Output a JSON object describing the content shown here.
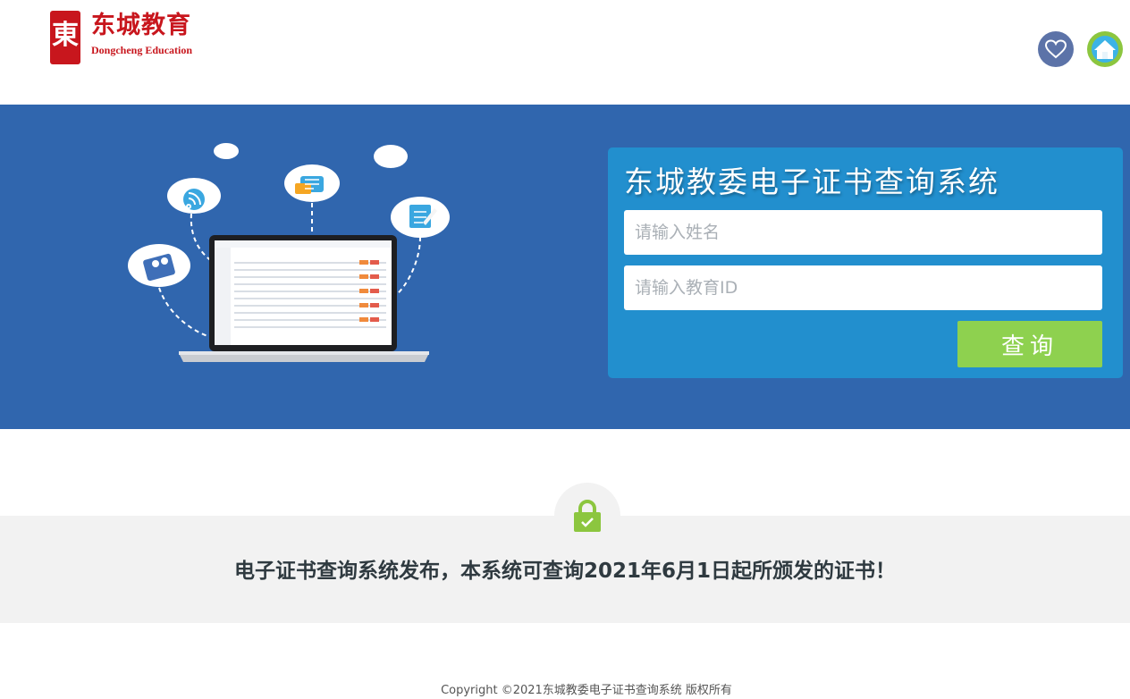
{
  "header": {
    "logo_glyph": "東",
    "logo_cn": "东城教育",
    "logo_en": "Dongcheng Education",
    "favorite_icon": "heart-icon",
    "home_icon": "home-icon"
  },
  "search_panel": {
    "title": "东城教委电子证书查询系统",
    "name_placeholder": "请输入姓名",
    "id_placeholder": "请输入教育ID",
    "query_label": "查询"
  },
  "notice": {
    "icon": "lock-icon",
    "text": "电子证书查询系统发布，本系统可查询2021年6月1日起所颁发的证书！"
  },
  "footer": {
    "copyright": "Copyright ©2021东城教委电子证书查询系统 版权所有"
  },
  "colors": {
    "brand_red": "#c8161d",
    "banner_blue": "#3066ae",
    "panel_blue": "#228fce",
    "query_green": "#8ed14f",
    "fav_blue": "#5c73a8",
    "home_green": "#8cc63f"
  }
}
